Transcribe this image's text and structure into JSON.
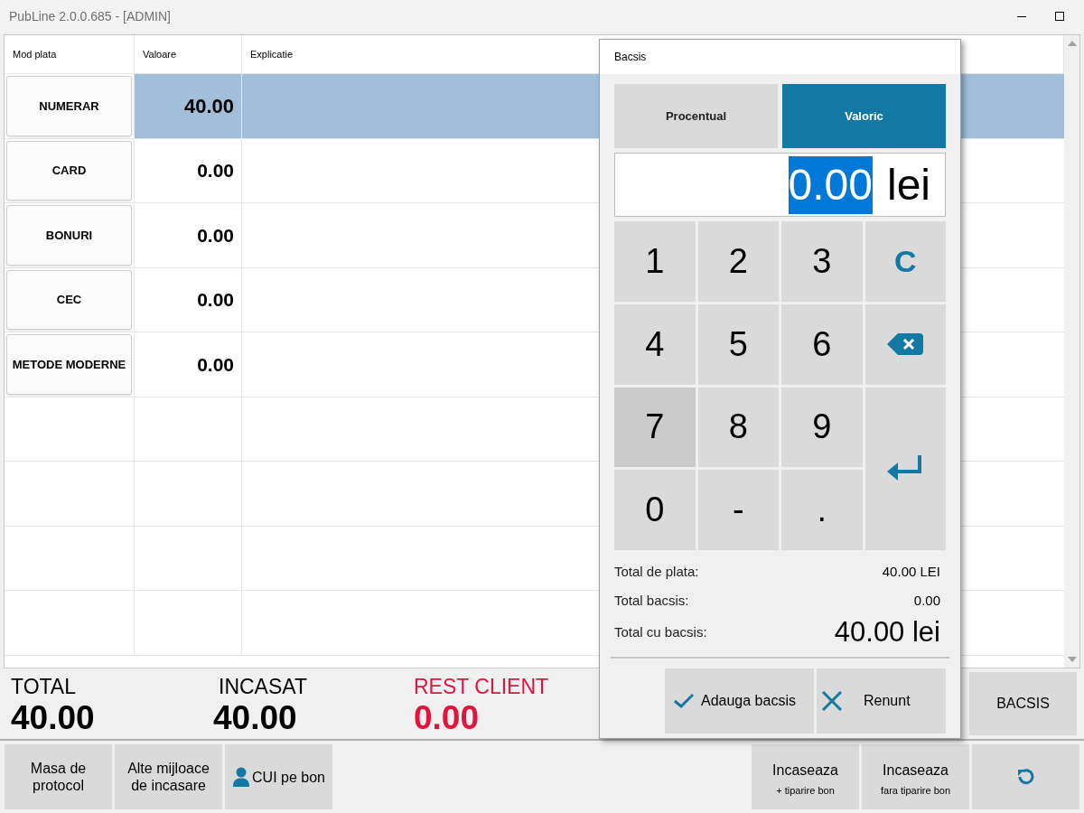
{
  "window": {
    "title": "PubLine 2.0.0.685 - [ADMIN]"
  },
  "table": {
    "columns": [
      "Mod plata",
      "Valoare",
      "Explicatie"
    ],
    "rows": [
      {
        "method": "NUMERAR",
        "value": "40.00",
        "selected": true
      },
      {
        "method": "CARD",
        "value": "0.00",
        "selected": false
      },
      {
        "method": "BONURI",
        "value": "0.00",
        "selected": false
      },
      {
        "method": "CEC",
        "value": "0.00",
        "selected": false
      },
      {
        "method": "METODE MODERNE",
        "value": "0.00",
        "selected": false
      }
    ]
  },
  "summary": [
    {
      "label": "TOTAL",
      "value": "40.00",
      "kind": "normal"
    },
    {
      "label": "INCASAT",
      "value": "40.00",
      "kind": "normal"
    },
    {
      "label": "REST CLIENT",
      "value": "0.00",
      "kind": "alert"
    }
  ],
  "bacsis_button": "BACSIS",
  "bottom_left_buttons": [
    {
      "label": "Masa de protocol",
      "icon": false
    },
    {
      "label": "Alte mijloace de incasare",
      "icon": false
    },
    {
      "label": "CUI pe bon",
      "icon": true
    }
  ],
  "bottom_right_buttons": [
    {
      "kind": "text",
      "label": "Incaseaza",
      "sublabel": "+ tiparire bon"
    },
    {
      "kind": "text",
      "label": "Incaseaza",
      "sublabel": "fara tiparire bon"
    },
    {
      "kind": "undo"
    }
  ],
  "dialog": {
    "title": "Bacsis",
    "modes": [
      {
        "label": "Procentual",
        "selected": false
      },
      {
        "label": "Valoric",
        "selected": true
      }
    ],
    "amount": {
      "value": "0.00",
      "unit": "lei"
    },
    "keys": [
      {
        "kind": "digit",
        "label": "1",
        "pressed": false
      },
      {
        "kind": "digit",
        "label": "2",
        "pressed": false
      },
      {
        "kind": "digit",
        "label": "3",
        "pressed": false
      },
      {
        "kind": "clear",
        "label": "C",
        "pressed": false
      },
      {
        "kind": "digit",
        "label": "4",
        "pressed": false
      },
      {
        "kind": "digit",
        "label": "5",
        "pressed": false
      },
      {
        "kind": "digit",
        "label": "6",
        "pressed": false
      },
      {
        "kind": "backspace",
        "pressed": false
      },
      {
        "kind": "digit",
        "label": "7",
        "pressed": true
      },
      {
        "kind": "digit",
        "label": "8",
        "pressed": false
      },
      {
        "kind": "digit",
        "label": "9",
        "pressed": false
      },
      {
        "kind": "enter",
        "pressed": false
      },
      {
        "kind": "digit",
        "label": "0",
        "pressed": false
      },
      {
        "kind": "digit",
        "label": "-",
        "pressed": false
      },
      {
        "kind": "digit",
        "label": ".",
        "pressed": false
      }
    ],
    "totals": [
      {
        "label": "Total de plata:",
        "value": "40.00 LEI",
        "kind": "normal"
      },
      {
        "label": "Total bacsis:",
        "value": "0.00",
        "kind": "normal"
      },
      {
        "label": "Total cu bacsis:",
        "value": "40.00 lei",
        "kind": "large"
      }
    ],
    "buttons": [
      {
        "kind": "ok",
        "label": "Adauga bacsis"
      },
      {
        "kind": "cancel",
        "label": "Renunt"
      }
    ]
  }
}
